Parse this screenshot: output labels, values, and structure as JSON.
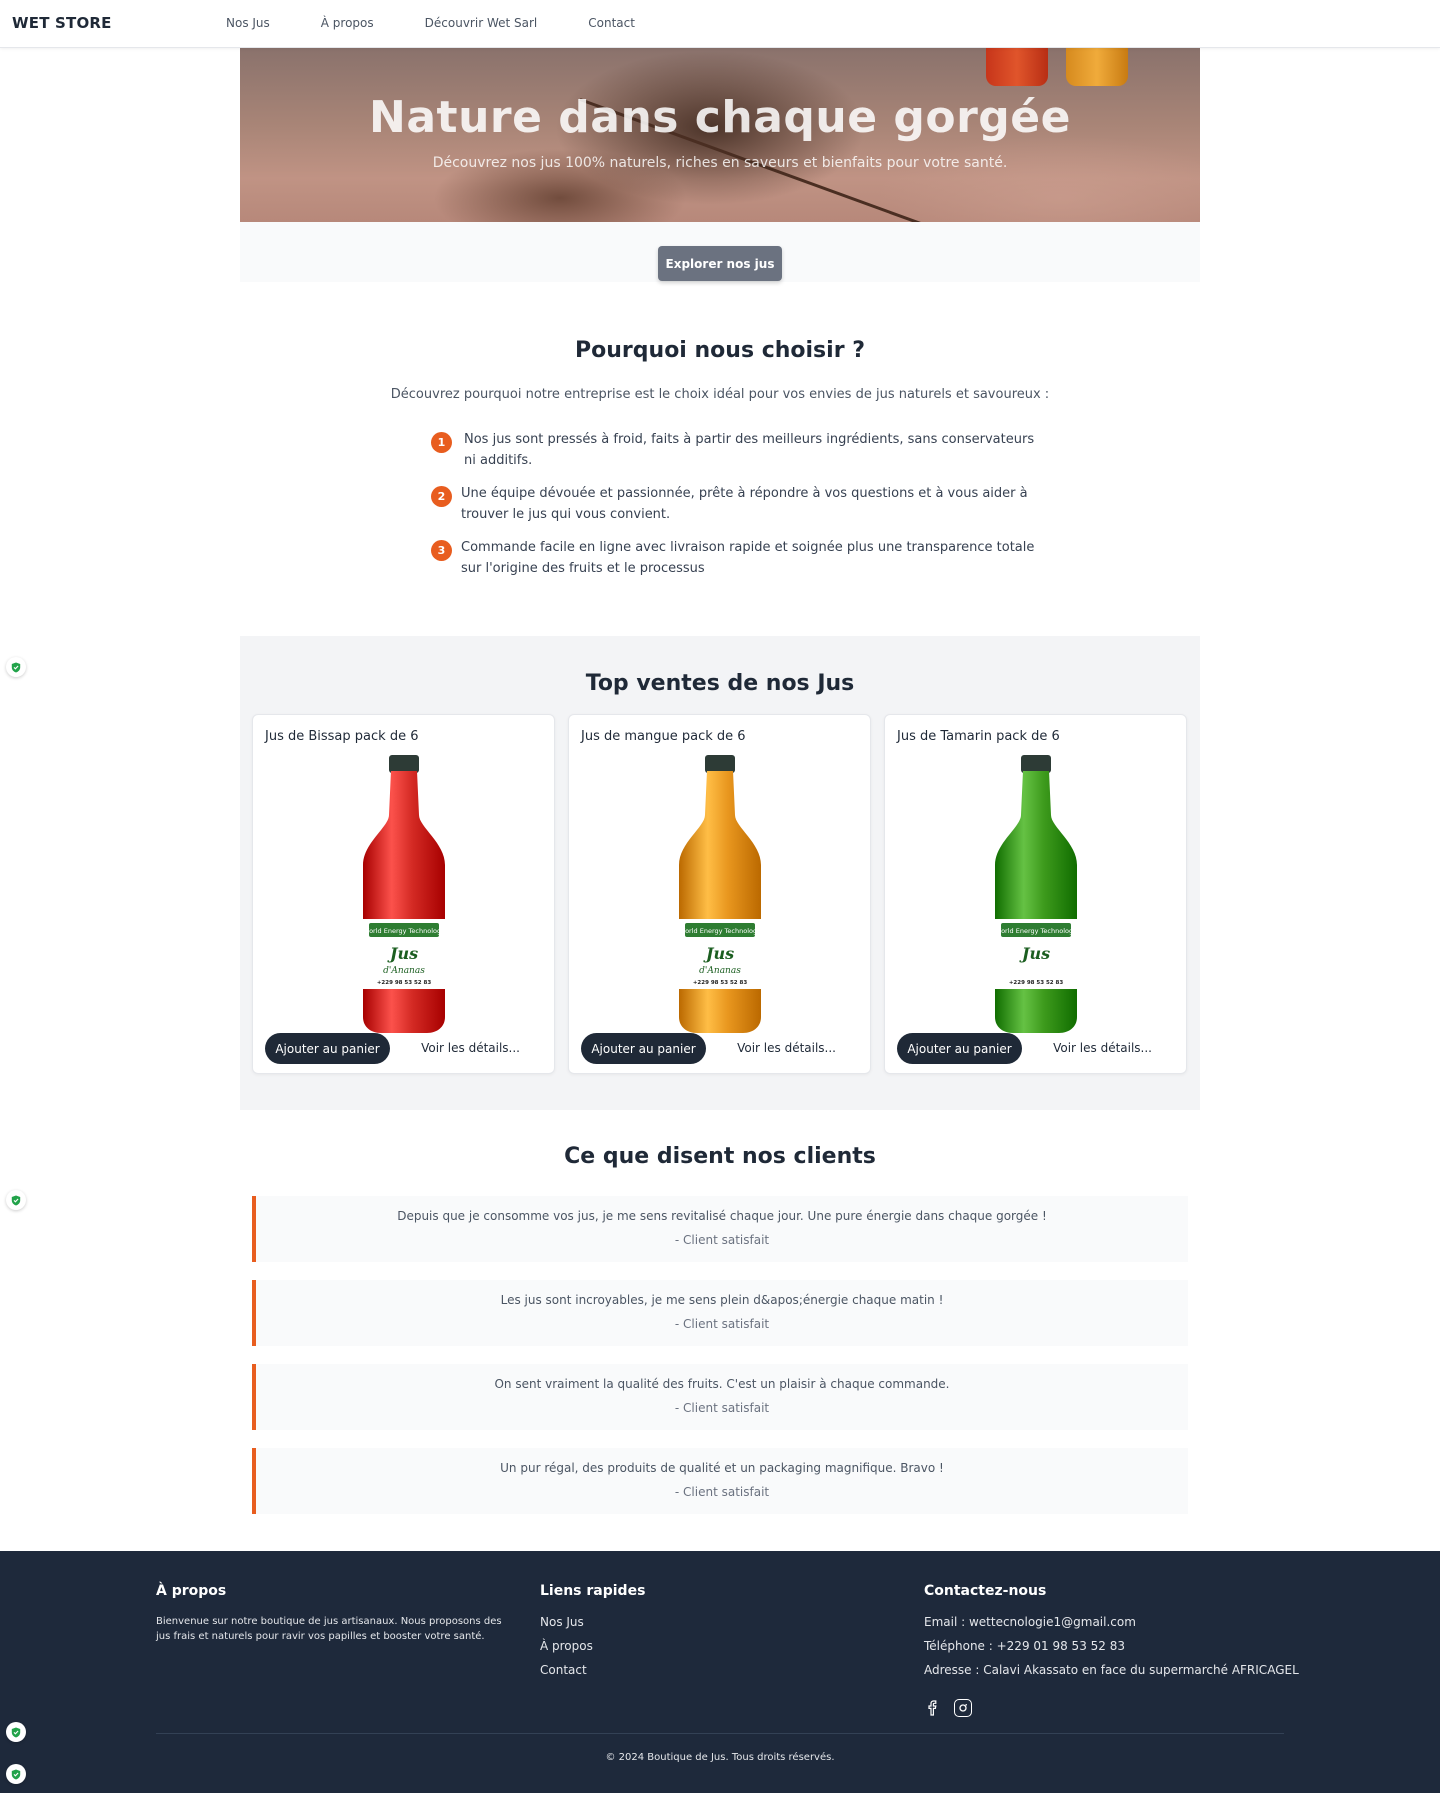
{
  "nav": {
    "brand": "WET STORE",
    "links": [
      "Nos Jus",
      "À propos",
      "Découvrir Wet Sarl",
      "Contact"
    ]
  },
  "hero": {
    "title": "Nature dans chaque gorgée",
    "subtitle": "Découvrez nos jus 100% naturels, riches en saveurs et bienfaits pour votre santé.",
    "cta": "Explorer nos jus"
  },
  "why": {
    "title": "Pourquoi nous choisir ?",
    "intro": "Découvrez pourquoi notre entreprise est le choix idéal pour vos envies de jus naturels et savoureux :",
    "reasons": [
      {
        "num": "1",
        "line1": "Nos jus sont pressés à froid, faits à partir des meilleurs ingrédients, sans conservateurs",
        "line2": "ni additifs."
      },
      {
        "num": "2",
        "line1": "Une équipe dévouée et passionnée, prête à répondre à vos questions et à vous aider à",
        "line2": "trouver le jus qui vous convient."
      },
      {
        "num": "3",
        "line1": "Commande facile en ligne avec livraison rapide et soignée plus une transparence totale",
        "line2": "sur l'origine des fruits et le processus"
      }
    ]
  },
  "sales": {
    "title": "Top ventes de nos Jus",
    "products": [
      {
        "name": "Jus de Bissap pack de 6",
        "add": "Ajouter au panier",
        "details": "Voir les détails...",
        "color": "#d42a24",
        "label_line": "d'Ananas"
      },
      {
        "name": "Jus de mangue pack de 6",
        "add": "Ajouter au panier",
        "details": "Voir les détails...",
        "color": "#e8961e",
        "label_line": "d'Ananas"
      },
      {
        "name": "Jus de Tamarin pack de 6",
        "add": "Ajouter au panier",
        "details": "Voir les détails...",
        "color": "#3d9a1c",
        "label_line": ""
      }
    ],
    "label_brand": "World Energy Technology",
    "label_jus": "Jus",
    "label_phone": "+229 98 53 52 83"
  },
  "testimonials": {
    "title": "Ce que disent nos clients",
    "items": [
      {
        "quote": "Depuis que je consomme vos jus, je me sens revitalisé chaque jour. Une pure énergie dans chaque gorgée !",
        "author": "- Client satisfait"
      },
      {
        "quote": "Les jus sont incroyables, je me sens plein d&apos;énergie chaque matin !",
        "author": "- Client satisfait"
      },
      {
        "quote": "On sent vraiment la qualité des fruits. C'est un plaisir à chaque commande.",
        "author": "- Client satisfait"
      },
      {
        "quote": "Un pur régal, des produits de qualité et un packaging magnifique. Bravo !",
        "author": "- Client satisfait"
      }
    ]
  },
  "footer": {
    "about_title": "À propos",
    "about_text": "Bienvenue sur notre boutique de jus artisanaux. Nous proposons des jus frais et naturels pour ravir vos papilles et booster votre santé.",
    "links_title": "Liens rapides",
    "links": [
      "Nos Jus",
      "À propos",
      "Contact"
    ],
    "contact_title": "Contactez-nous",
    "email": "Email : wettecnologie1@gmail.com",
    "phone": "Téléphone : +229 01 98 53 52 83",
    "address": "Adresse : Calavi Akassato en face du supermarché AFRICAGEL",
    "social": [
      "facebook-icon",
      "instagram-icon"
    ],
    "copyright": "© 2024 Boutique de Jus. Tous droits réservés."
  },
  "colors": {
    "accent": "#e85d1f",
    "dark": "#1f2937",
    "footer_bg": "#1e293b"
  }
}
